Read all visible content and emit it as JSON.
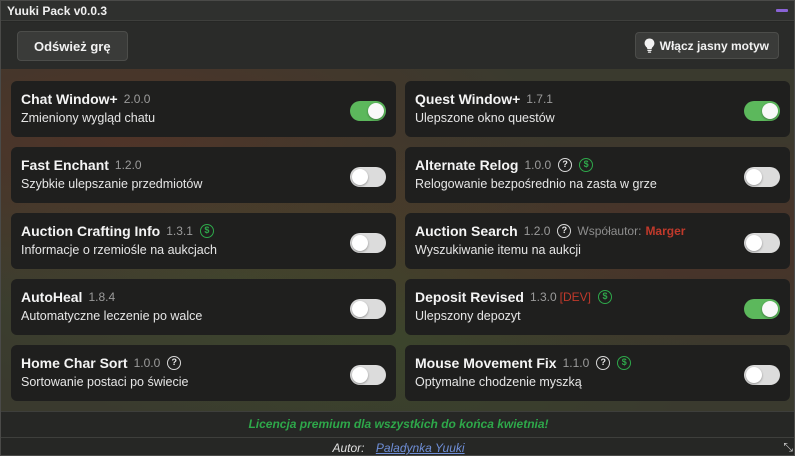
{
  "window": {
    "title": "Yuuki Pack v0.0.3"
  },
  "toolbar": {
    "refresh_label": "Odśwież grę",
    "theme_label": "Włącz jasny motyw"
  },
  "colors": {
    "accent_purple": "#8a63d6",
    "toggle_on": "#5cb85c",
    "premium_green": "#2ea84a",
    "dev_red": "#c0392b",
    "link_blue": "#6f8fd8"
  },
  "addons": [
    {
      "name": "Chat Window+",
      "version": "2.0.0",
      "desc": "Zmieniony wygląd chatu",
      "enabled": true
    },
    {
      "name": "Quest Window+",
      "version": "1.7.1",
      "desc": "Ulepszone okno questów",
      "enabled": true
    },
    {
      "name": "Fast Enchant",
      "version": "1.2.0",
      "desc": "Szybkie ulepszanie przedmiotów",
      "enabled": false
    },
    {
      "name": "Alternate Relog",
      "version": "1.0.0",
      "desc": "Relogowanie bezpośrednio na zasta w grze",
      "enabled": false,
      "help": true,
      "premium": true
    },
    {
      "name": "Auction Crafting Info",
      "version": "1.3.1",
      "desc": "Informacje o rzemiośle na aukcjach",
      "enabled": false,
      "premium": true
    },
    {
      "name": "Auction Search",
      "version": "1.2.0",
      "desc": "Wyszukiwanie itemu na aukcji",
      "enabled": false,
      "help": true,
      "coauthor_label": "Współautor:",
      "coauthor": "Marger"
    },
    {
      "name": "AutoHeal",
      "version": "1.8.4",
      "desc": "Automatyczne leczenie po walce",
      "enabled": false
    },
    {
      "name": "Deposit Revised",
      "version": "1.3.0",
      "desc": "Ulepszony depozyt",
      "enabled": true,
      "dev": "[DEV]",
      "premium": true
    },
    {
      "name": "Home Char Sort",
      "version": "1.0.0",
      "desc": "Sortowanie postaci po świecie",
      "enabled": false,
      "help": true
    },
    {
      "name": "Mouse Movement Fix",
      "version": "1.1.0",
      "desc": "Optymalne chodzenie myszką",
      "enabled": false,
      "help": true,
      "premium": true
    }
  ],
  "icons": {
    "help": "question-circle-icon",
    "premium": "dollar-circle-icon",
    "theme": "lightbulb-icon",
    "resize": "resize-handle-icon"
  },
  "glyphs": {
    "help": "?",
    "premium": "$",
    "resize": "⤡"
  },
  "footer": {
    "license": "Licencja premium dla wszystkich do końca kwietnia!",
    "author_label": "Autor:",
    "author_name": "Paladynka Yuuki"
  }
}
